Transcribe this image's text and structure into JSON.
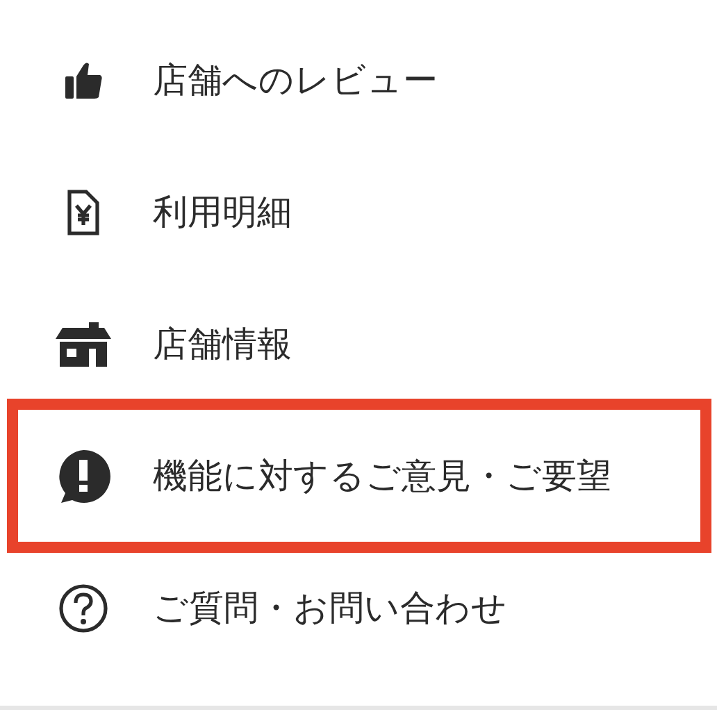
{
  "menu": [
    {
      "kind": "thumbs",
      "label": "店舗へのレビュー",
      "selected": false
    },
    {
      "kind": "receipt",
      "label": "利用明細",
      "selected": false
    },
    {
      "kind": "store",
      "label": "店舗情報",
      "selected": false
    },
    {
      "kind": "feedback",
      "label": "機能に対するご意見・ご要望",
      "selected": true
    },
    {
      "kind": "help",
      "label": "ご質問・お問い合わせ",
      "selected": false
    }
  ]
}
